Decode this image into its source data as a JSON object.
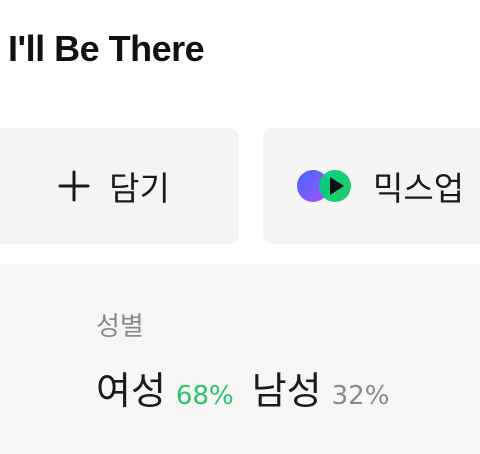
{
  "song": {
    "title": "I'll Be There"
  },
  "actions": {
    "add": {
      "label": "담기",
      "icon": "plus-icon"
    },
    "mixup": {
      "label": "믹스업",
      "icon": "mixup-play-icon"
    }
  },
  "stats": {
    "label": "성별",
    "female": {
      "name": "여성",
      "percent": "68%",
      "color": "#2cc46a"
    },
    "male": {
      "name": "남성",
      "percent": "32%",
      "color": "#8a8a8a"
    }
  }
}
